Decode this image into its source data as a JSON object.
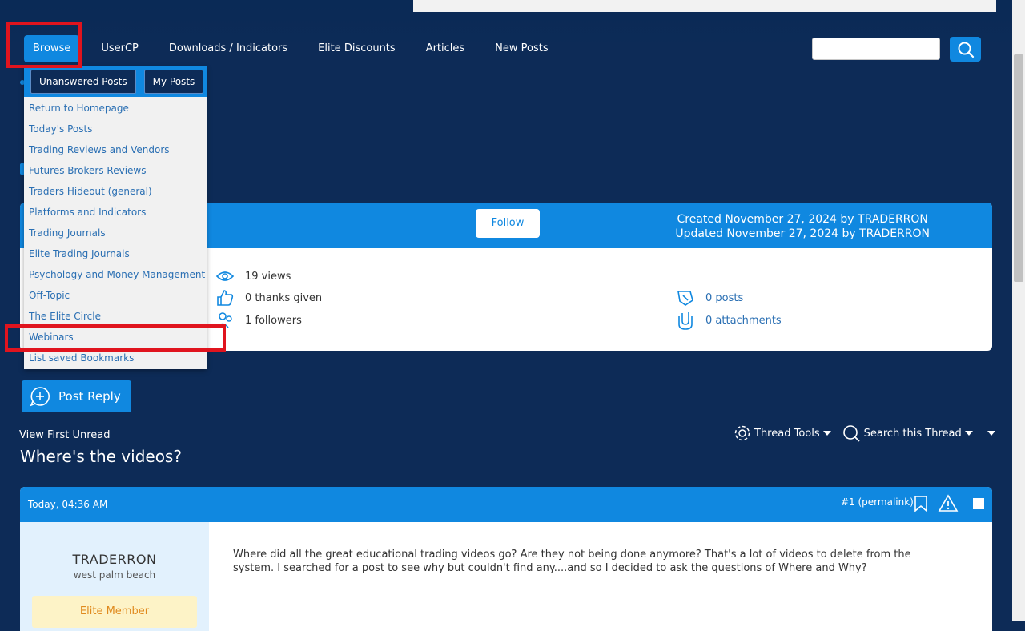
{
  "nav": {
    "items": [
      "Browse",
      "UserCP",
      "Downloads / Indicators",
      "Elite Discounts",
      "Articles",
      "New Posts"
    ]
  },
  "dropdown": {
    "buttons": [
      "Unanswered Posts",
      "My Posts"
    ],
    "items": [
      "Return to Homepage",
      "Today's Posts",
      "Trading Reviews and Vendors",
      "Futures Brokers Reviews",
      "Traders Hideout (general)",
      "Platforms and Indicators",
      "Trading Journals",
      "Elite Trading Journals",
      "Psychology and Money Management",
      "Off-Topic",
      "The Elite Circle",
      "Webinars",
      "List saved Bookmarks"
    ]
  },
  "thread_info": {
    "follow_label": "Follow",
    "created": "Created November 27, 2024 by TRADERRON",
    "updated": "Updated November 27, 2024 by TRADERRON",
    "views": "19 views",
    "thanks": "0 thanks given",
    "followers": "1 followers",
    "posts": "0 posts",
    "attachments": "0 attachments"
  },
  "post_reply_label": "Post Reply",
  "view_first_unread": "View First Unread",
  "thread_title": "Where's the videos?",
  "tools": {
    "thread_tools": "Thread Tools",
    "search_thread": "Search this Thread"
  },
  "post": {
    "date": "Today, 04:36 AM",
    "permalink": "#1 (permalink)",
    "username": "TRADERRON",
    "location": "west palm beach",
    "badge": "Elite Member",
    "body": "Where did all the great educational trading videos go? Are they not being done anymore? That's a lot of videos to delete from the system. I searched for a post to see why but couldn't find any....and so I decided to ask the questions of Where and Why?"
  },
  "colors": {
    "background": "#0d2b57",
    "accent": "#1088e0",
    "highlight": "#e0141e"
  }
}
